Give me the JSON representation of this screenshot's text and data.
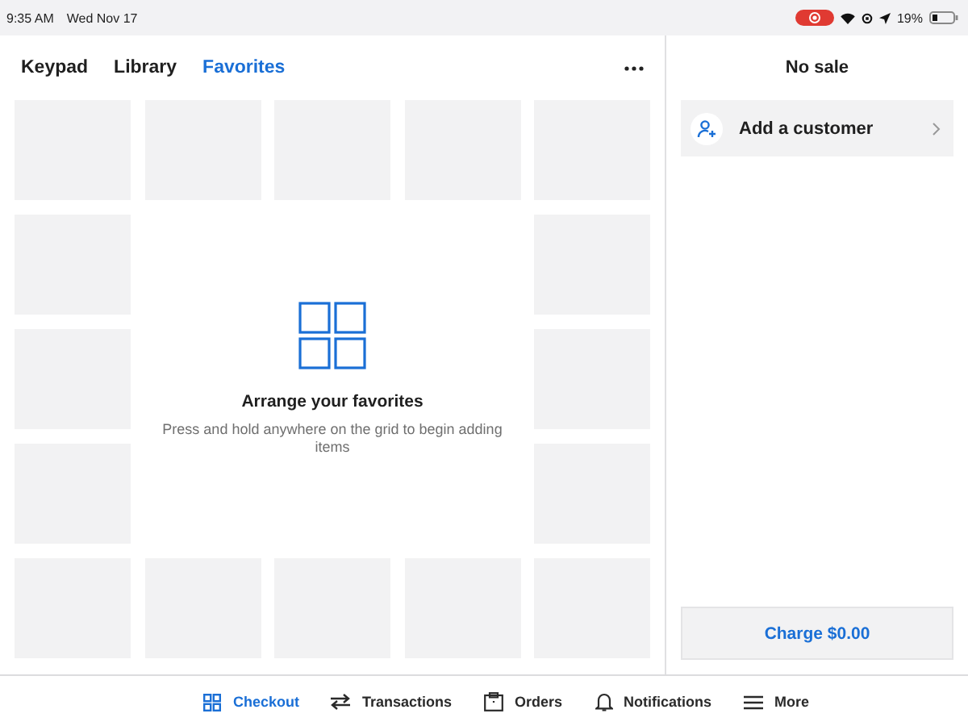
{
  "status_bar": {
    "time": "9:35 AM",
    "date": "Wed Nov 17",
    "recording": true,
    "battery": "19%"
  },
  "tabs": [
    {
      "label": "Keypad",
      "selected": false
    },
    {
      "label": "Library",
      "selected": false
    },
    {
      "label": "Favorites",
      "selected": true
    }
  ],
  "empty_state": {
    "title": "Arrange your favorites",
    "message": "Press and hold anywhere on the grid to begin adding items"
  },
  "sale": {
    "title": "No sale",
    "customer_action": "Add a customer",
    "charge_button": "Charge $0.00"
  },
  "nav": [
    {
      "kind": "checkout",
      "label": "Checkout",
      "selected": true
    },
    {
      "kind": "transactions",
      "label": "Transactions",
      "selected": false
    },
    {
      "kind": "orders",
      "label": "Orders",
      "selected": false
    },
    {
      "kind": "notifications",
      "label": "Notifications",
      "selected": false
    },
    {
      "kind": "more",
      "label": "More",
      "selected": false
    }
  ]
}
